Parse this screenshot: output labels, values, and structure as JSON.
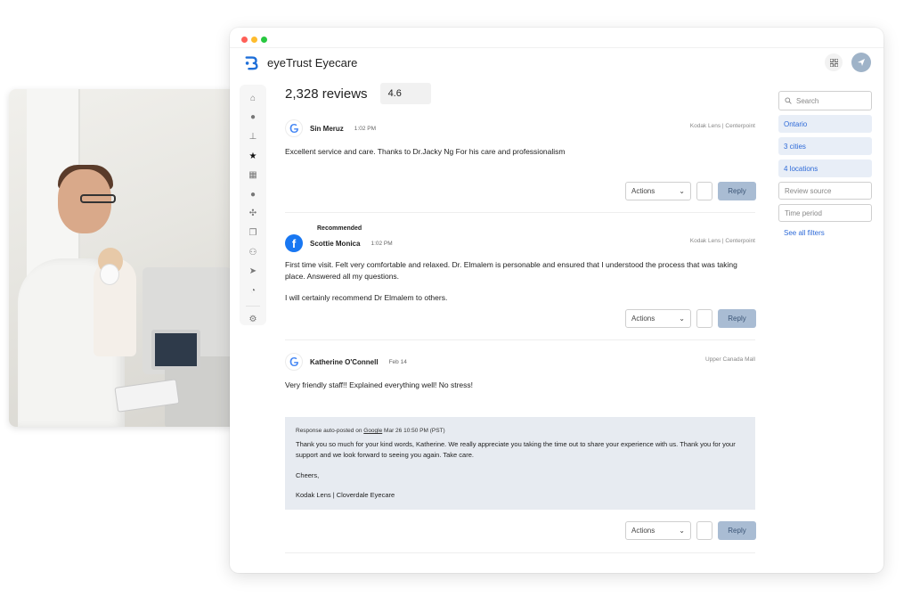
{
  "app": {
    "name": "eyeTrust Eyecare",
    "window_dots": [
      "#ff5f57",
      "#febc2e",
      "#28c840"
    ],
    "accent": "#2f6bd8"
  },
  "summary": {
    "count_label": "2,328 reviews",
    "rating": "4.6"
  },
  "sidebar": {
    "items": [
      {
        "icon": "home-icon",
        "glyph": "⌂"
      },
      {
        "icon": "chat-icon",
        "glyph": "●"
      },
      {
        "icon": "stamp-icon",
        "glyph": "⊥"
      },
      {
        "icon": "star-icon",
        "glyph": "★"
      },
      {
        "icon": "qr-icon",
        "glyph": "▦"
      },
      {
        "icon": "alert-icon",
        "glyph": "●"
      },
      {
        "icon": "network-icon",
        "glyph": "✣"
      },
      {
        "icon": "copy-icon",
        "glyph": "❐"
      },
      {
        "icon": "users-icon",
        "glyph": "⚇"
      },
      {
        "icon": "send-icon",
        "glyph": "➤"
      },
      {
        "icon": "pie-chart-icon",
        "glyph": "◔"
      },
      {
        "icon": "settings-icon",
        "glyph": "⚙"
      }
    ]
  },
  "reviews": [
    {
      "source": "google",
      "name": "Sin Meruz",
      "time": "1:02 PM",
      "location": "Kodak Lens | Centerpoint",
      "text": [
        "Excellent service and care. Thanks to Dr.Jacky Ng For his care and professionalism"
      ]
    },
    {
      "source": "facebook",
      "tag": "Recommended",
      "name": "Scottie Monica",
      "time": "1:02 PM",
      "location": "Kodak Lens | Centerpoint",
      "text": [
        "First time visit. Felt very comfortable and relaxed. Dr. Elmalem is personable and ensured that I understood the process that was taking place. Answered all my questions.",
        "I will certainly recommend Dr Elmalem to others."
      ]
    },
    {
      "source": "google",
      "name": "Katherine O'Connell",
      "time": "Feb 14",
      "location": "Upper Canada Mall",
      "text": [
        "Very friendly staff!! Explained everything well! No stress!"
      ]
    }
  ],
  "response": {
    "meta_prefix": "Response auto-posted on",
    "meta_platform": "Google",
    "meta_date": "Mar 26 10:50 PM (PST)",
    "body": [
      "Thank you so much for your kind words, Katherine. We really appreciate you taking the time out to share your experience with us. Thank you for your support and we look forward to seeing you again. Take care.",
      "Cheers,",
      "Kodak Lens | Cloverdale Eyecare"
    ]
  },
  "controls": {
    "actions_label": "Actions",
    "reply_label": "Reply"
  },
  "filters": {
    "search_placeholder": "Search",
    "chips": [
      "Ontario",
      "3 cities",
      "4 locations"
    ],
    "inputs": [
      "Review source",
      "Time period"
    ],
    "see_all": "See all filters"
  }
}
